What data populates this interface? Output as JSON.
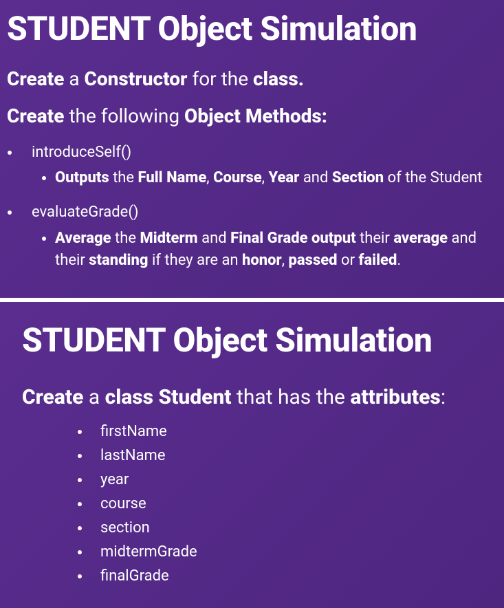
{
  "slide1": {
    "title": "STUDENT Object Simulation",
    "line1": {
      "b1": "Create ",
      "t1": "a ",
      "b2": "Constructor ",
      "t2": "for the ",
      "b3": "class."
    },
    "line2": {
      "b1": "Create ",
      "t1": "the following ",
      "b2": "Object Methods:"
    },
    "method1": {
      "name": "introduceSelf()",
      "detail": {
        "b1": "Outputs ",
        "t1": "the ",
        "b2": "Full Name",
        "t2": ", ",
        "b3": "Course",
        "t3": ", ",
        "b4": "Year ",
        "t4": "and ",
        "b5": "Section ",
        "t5": "of the Student"
      }
    },
    "method2": {
      "name": "evaluateGrade()",
      "detail": {
        "b1": "Average ",
        "t1": "the ",
        "b2": "Midterm ",
        "t2": "and ",
        "b3": "Final Grade output ",
        "t3": "their ",
        "b4": "average ",
        "t4": "and their ",
        "b5": "standing ",
        "t5": "if they are an ",
        "b6": "honor",
        "t6": ", ",
        "b7": "passed ",
        "t7": "or ",
        "b8": "failed",
        "t8": "."
      }
    }
  },
  "slide2": {
    "title": "STUDENT Object Simulation",
    "line": {
      "b1": "Create ",
      "t1": "a ",
      "b2": "class Student ",
      "t2": "that has the ",
      "b3": "attributes",
      "t3": ":"
    },
    "attributes": [
      "firstName",
      "lastName",
      "year",
      "course",
      "section",
      "midtermGrade",
      "finalGrade"
    ]
  }
}
